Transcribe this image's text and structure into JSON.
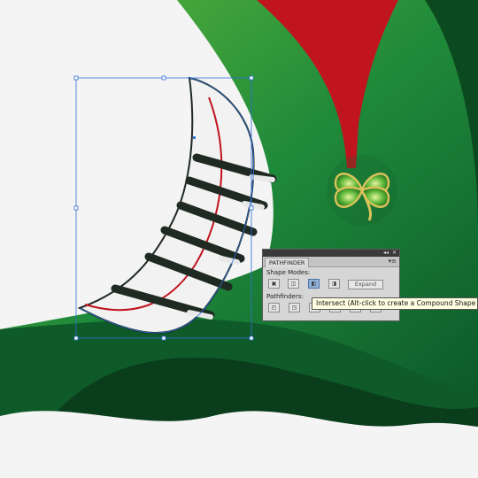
{
  "panel": {
    "collapse_glyph": "◂◂",
    "close_glyph": "✕",
    "title": "PATHFINDER",
    "menu_glyph": "▾≡",
    "shape_modes_label": "Shape Modes:",
    "pathfinders_label": "Pathfinders:",
    "expand_label": "Expand",
    "shape_mode_buttons": [
      {
        "icon": "unite-icon",
        "glyph": "▣"
      },
      {
        "icon": "minus-front-icon",
        "glyph": "◫"
      },
      {
        "icon": "intersect-icon",
        "glyph": "◧"
      },
      {
        "icon": "exclude-icon",
        "glyph": "◨"
      }
    ],
    "pathfinder_buttons": [
      {
        "icon": "divide-icon",
        "glyph": "◰"
      },
      {
        "icon": "trim-icon",
        "glyph": "◳"
      },
      {
        "icon": "merge-icon",
        "glyph": "◲"
      },
      {
        "icon": "crop-icon",
        "glyph": "◱"
      },
      {
        "icon": "outline-icon",
        "glyph": "◰"
      },
      {
        "icon": "minus-back-icon",
        "glyph": "◳"
      }
    ]
  },
  "tooltip": {
    "text": "Intersect (Alt-click to create a Compound Shape"
  },
  "colors": {
    "background": "#f4f4f4",
    "green_light": "#3aa046",
    "green_dark": "#0e4d22",
    "red": "#c0141e",
    "selection_blue": "#2f6fd6",
    "lace_dark": "#1f2a22",
    "clover_gold": "#d9c25a"
  }
}
